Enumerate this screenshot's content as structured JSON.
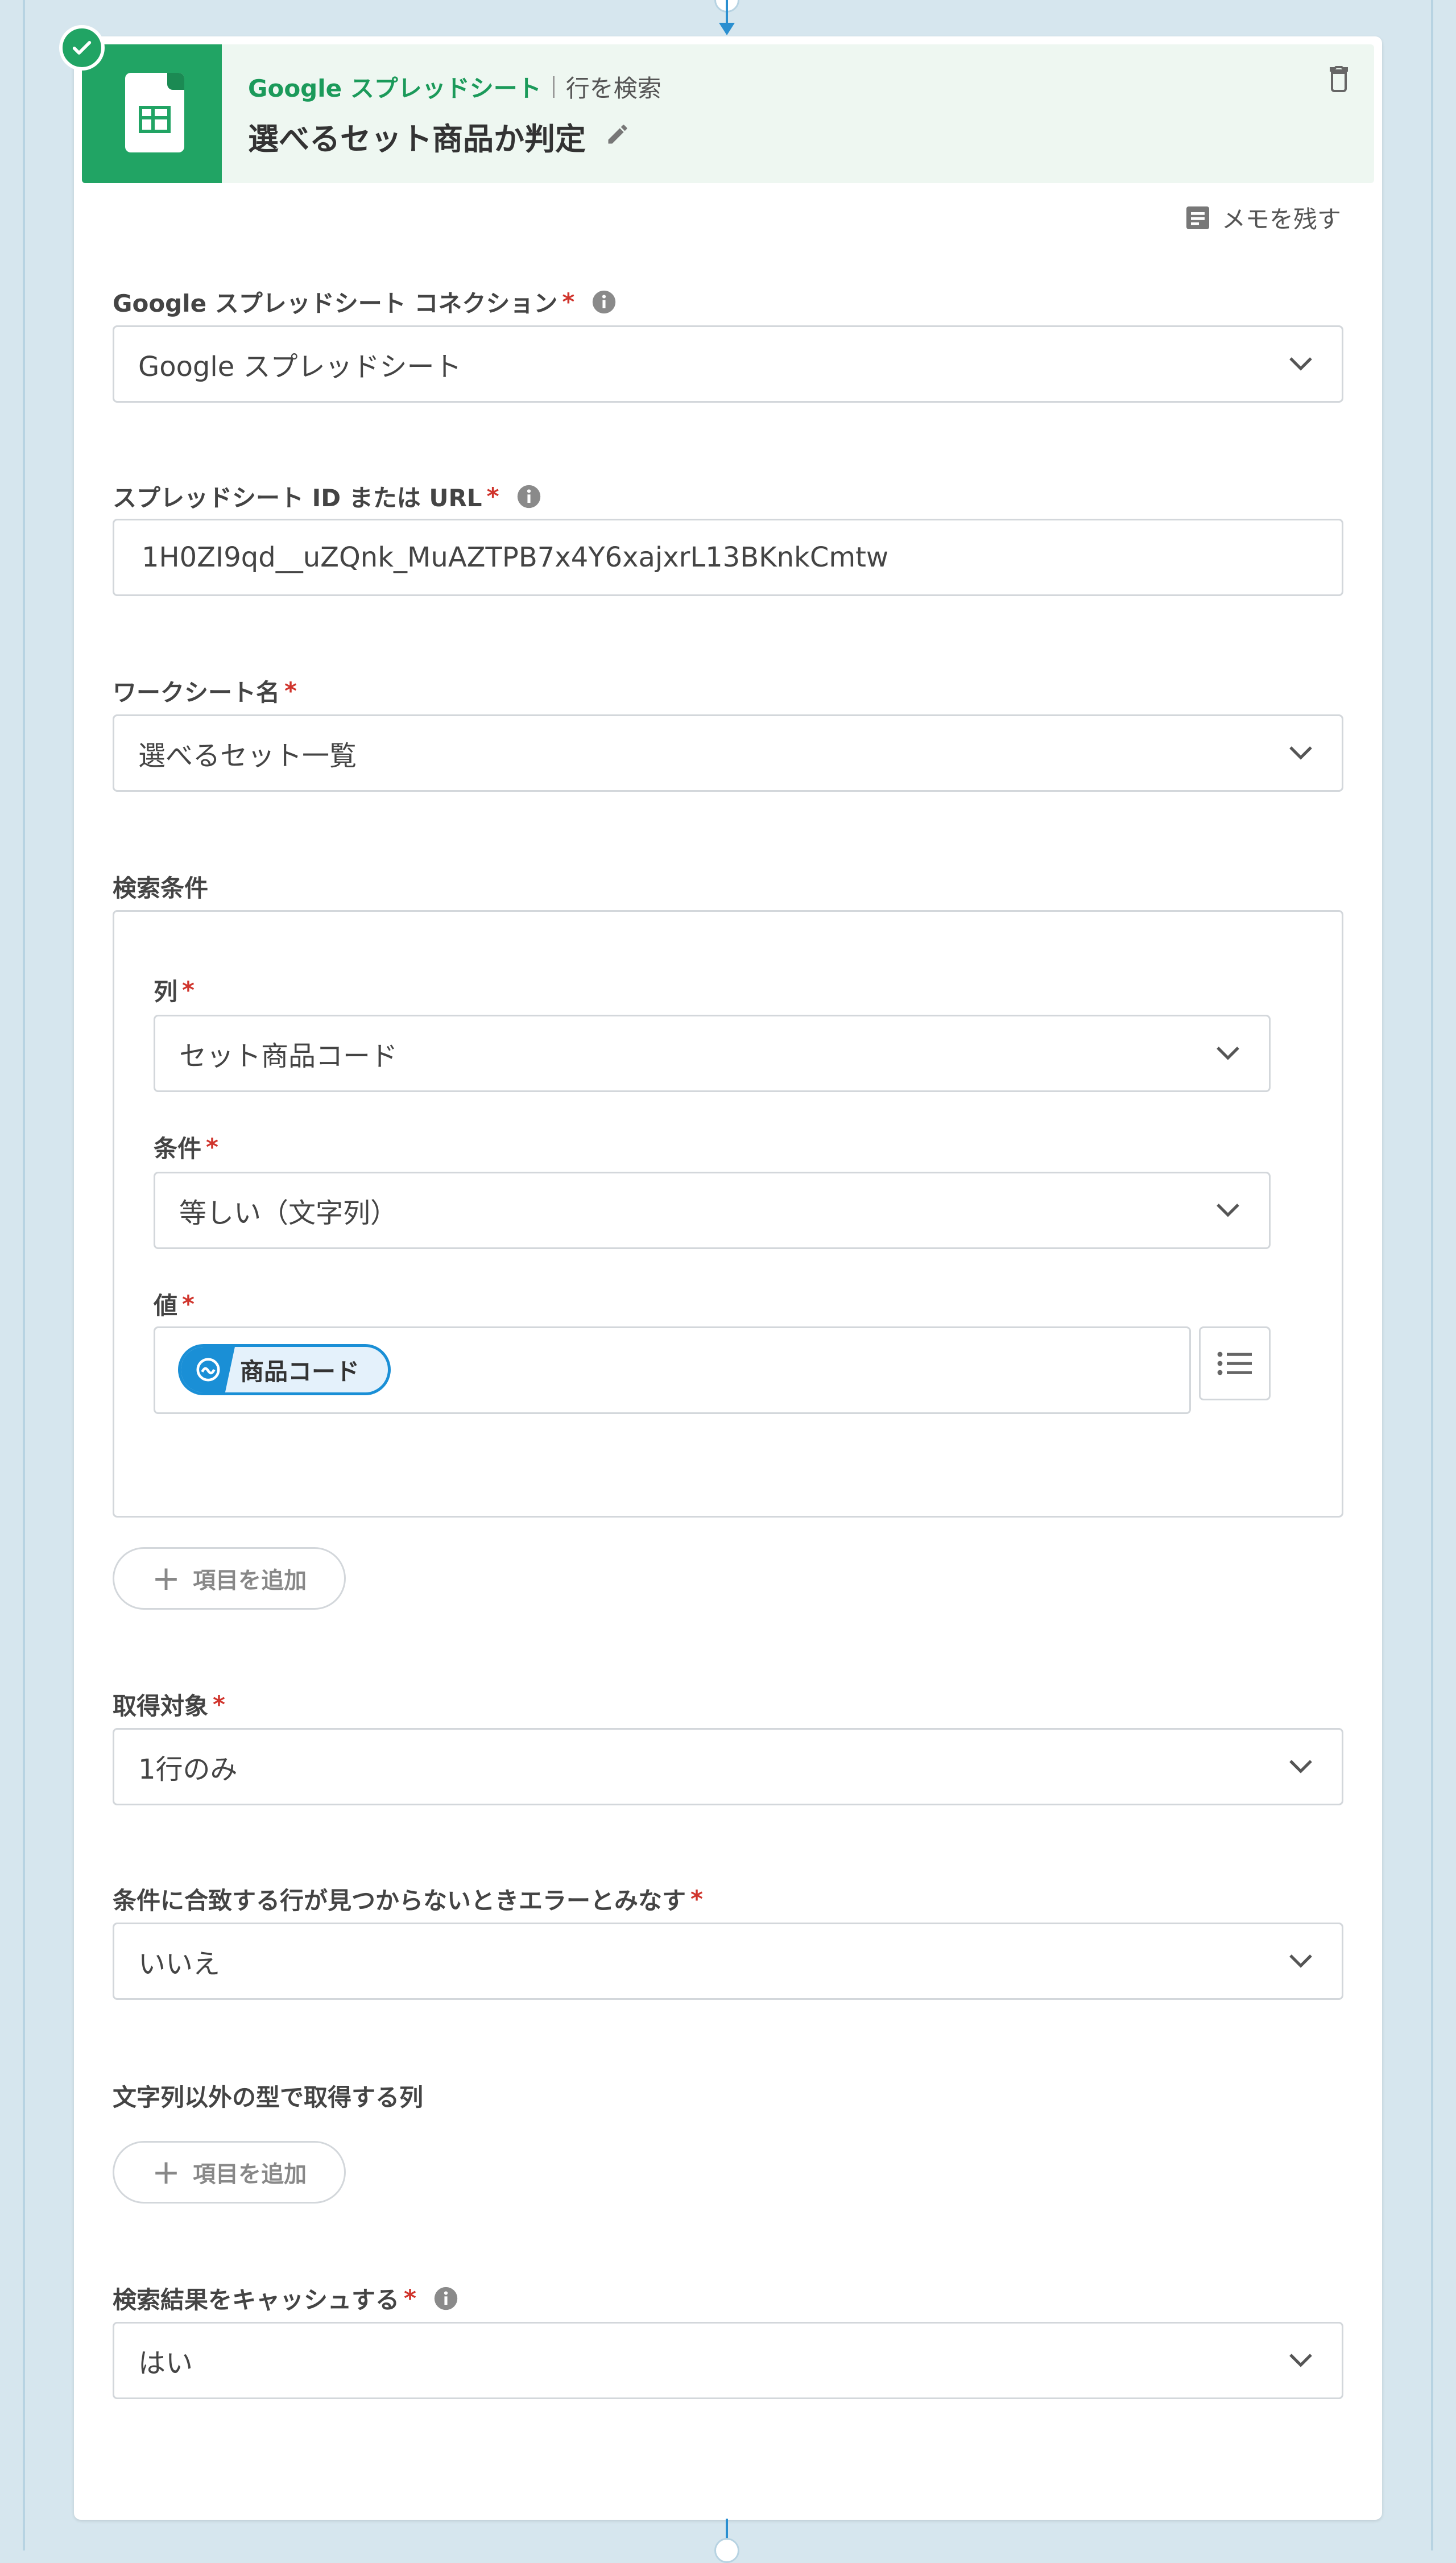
{
  "header": {
    "service_name": "Google スプレッドシート",
    "action": "行を検索",
    "step_title": "選べるセット商品か判定"
  },
  "memo_label": "メモを残す",
  "fields": {
    "connection": {
      "label": "Google スプレッドシート コネクション",
      "value": "Google スプレッドシート"
    },
    "spreadsheet": {
      "label": "スプレッドシート ID または URL",
      "value": "1H0ZI9qd__uZQnk_MuAZTPB7x4Y6xajxrL13BKnkCmtw"
    },
    "worksheet": {
      "label": "ワークシート名",
      "value": "選べるセット一覧"
    },
    "search_conditions": {
      "label": "検索条件",
      "column": {
        "label": "列",
        "value": "セット商品コード"
      },
      "condition": {
        "label": "条件",
        "value": "等しい（文字列）"
      },
      "value": {
        "label": "値",
        "chip": "商品コード"
      },
      "add_label": "項目を追加"
    },
    "target": {
      "label": "取得対象",
      "value": "1行のみ"
    },
    "not_found_error": {
      "label": "条件に合致する行が見つからないときエラーとみなす",
      "value": "いいえ"
    },
    "non_string_columns": {
      "label": "文字列以外の型で取得する列",
      "add_label": "項目を追加"
    },
    "cache": {
      "label": "検索結果をキャッシュする",
      "value": "はい"
    }
  },
  "required_mark": "*",
  "colors": {
    "accent_green": "#21a464",
    "required_red": "#d0342c",
    "chip_blue": "#1a8fd6",
    "connector_blue": "#2a8fd0"
  }
}
